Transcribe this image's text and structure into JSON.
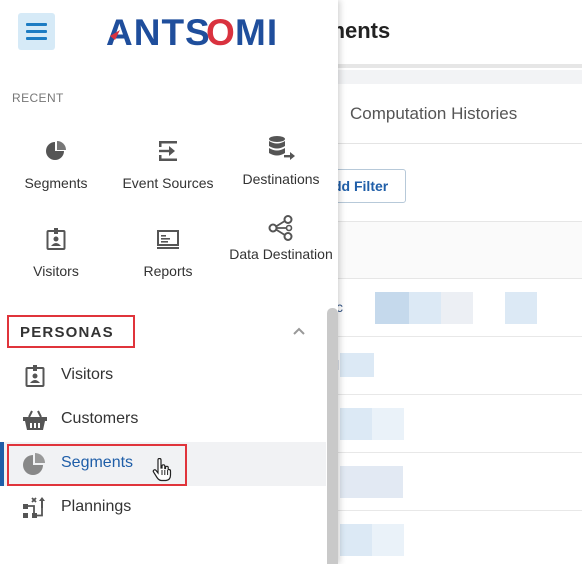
{
  "background": {
    "title": "gments",
    "tab_label": "Computation Histories",
    "add_filter_label": "dd Filter",
    "row_glyphs": [
      "c",
      "l",
      "",
      "",
      ""
    ]
  },
  "drawer": {
    "logo_text": "ANTSOMI",
    "recent": {
      "label": "RECENT",
      "items": [
        {
          "label": "Segments",
          "icon": "pie-chart-icon"
        },
        {
          "label": "Event Sources",
          "icon": "event-source-icon"
        },
        {
          "label": "Destinations",
          "icon": "database-export-icon"
        },
        {
          "label": "Visitors",
          "icon": "badge-icon"
        },
        {
          "label": "Reports",
          "icon": "report-icon"
        },
        {
          "label": "Data Destination",
          "icon": "share-nodes-icon"
        }
      ]
    },
    "personas": {
      "label": "PERSONAS",
      "items": [
        {
          "label": "Visitors",
          "icon": "badge-icon"
        },
        {
          "label": "Customers",
          "icon": "basket-icon"
        },
        {
          "label": "Segments",
          "icon": "pie-chart-icon",
          "active": true
        },
        {
          "label": "Plannings",
          "icon": "planning-icon"
        }
      ]
    }
  },
  "colors": {
    "brand_blue": "#1f4e9c",
    "brand_red": "#d9323f",
    "active_blue": "#1f5ea8",
    "highlight_red": "#e0343b"
  }
}
